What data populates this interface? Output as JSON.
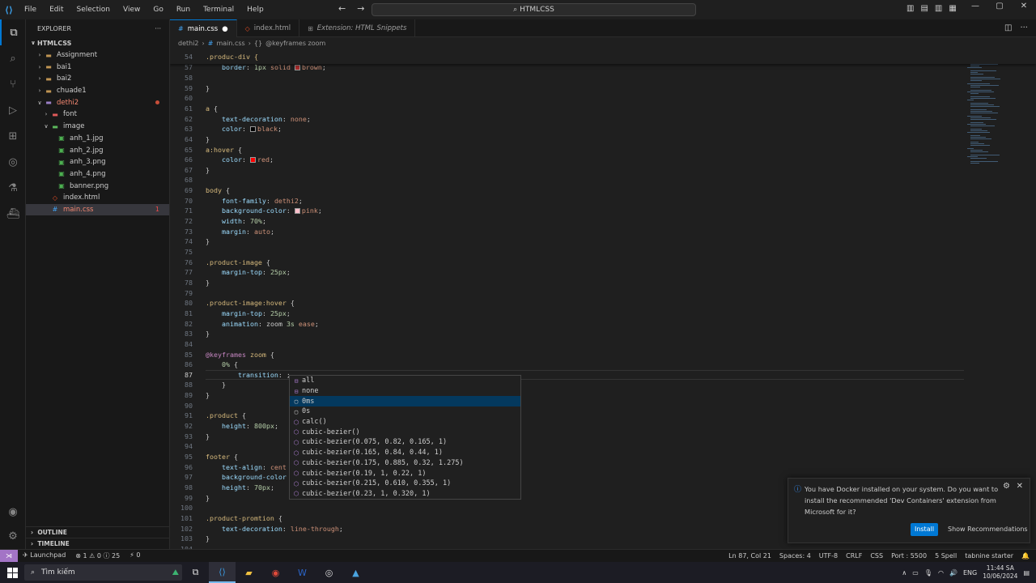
{
  "menu": [
    "File",
    "Edit",
    "Selection",
    "View",
    "Go",
    "Run",
    "Terminal",
    "Help"
  ],
  "search": {
    "text": "HTMLCSS"
  },
  "sidebar": {
    "title": "EXPLORER",
    "root": "HTMLCSS",
    "items": [
      {
        "label": "Assignment",
        "type": "folder",
        "depth": 1,
        "open": false
      },
      {
        "label": "bai1",
        "type": "folder",
        "depth": 1,
        "open": false
      },
      {
        "label": "bai2",
        "type": "folder",
        "depth": 1,
        "open": false
      },
      {
        "label": "chuade1",
        "type": "folder",
        "depth": 1,
        "open": false
      },
      {
        "label": "dethi2",
        "type": "folder",
        "depth": 1,
        "open": true,
        "error": true
      },
      {
        "label": "font",
        "type": "folder",
        "depth": 2,
        "open": false
      },
      {
        "label": "image",
        "type": "folder",
        "depth": 2,
        "open": true
      },
      {
        "label": "anh_1.jpg",
        "type": "img",
        "depth": 3
      },
      {
        "label": "anh_2.jpg",
        "type": "img",
        "depth": 3
      },
      {
        "label": "anh_3.png",
        "type": "img",
        "depth": 3
      },
      {
        "label": "anh_4.png",
        "type": "img",
        "depth": 3
      },
      {
        "label": "banner.png",
        "type": "img",
        "depth": 3
      },
      {
        "label": "index.html",
        "type": "html",
        "depth": 2
      },
      {
        "label": "main.css",
        "type": "css",
        "depth": 2,
        "selected": true,
        "count": "1"
      }
    ],
    "outline": "OUTLINE",
    "timeline": "TIMELINE"
  },
  "tabs": [
    {
      "label": "main.css",
      "active": true,
      "icon": "css-file-icon",
      "dirty": true
    },
    {
      "label": "index.html",
      "active": false,
      "icon": "html-file-icon"
    },
    {
      "label": "Extension: HTML Snippets",
      "active": false,
      "icon": "extension-icon",
      "italic": true
    }
  ],
  "breadcrumb": {
    "folder": "dethi2",
    "file": "main.css",
    "symbol": "@keyframes zoom"
  },
  "sticky": {
    "num": "54",
    "text": ".produc-div {"
  },
  "lines": [
    {
      "n": "57",
      "t": [
        [
          "    ",
          "punct"
        ],
        [
          "border",
          "prop"
        ],
        [
          ": ",
          "punct"
        ],
        [
          "1px",
          "num"
        ],
        [
          " solid ",
          "val"
        ],
        [
          "#SW#brown",
          "val"
        ],
        [
          ";",
          "punct"
        ]
      ]
    },
    {
      "n": "58",
      "t": []
    },
    {
      "n": "59",
      "t": [
        [
          "}",
          "brace"
        ]
      ]
    },
    {
      "n": "60",
      "t": []
    },
    {
      "n": "61",
      "t": [
        [
          "a",
          "sel"
        ],
        [
          " {",
          "brace"
        ]
      ]
    },
    {
      "n": "62",
      "t": [
        [
          "    ",
          "punct"
        ],
        [
          "text-decoration",
          "prop"
        ],
        [
          ": ",
          "punct"
        ],
        [
          "none",
          "val"
        ],
        [
          ";",
          "punct"
        ]
      ]
    },
    {
      "n": "63",
      "t": [
        [
          "    ",
          "punct"
        ],
        [
          "color",
          "prop"
        ],
        [
          ": ",
          "punct"
        ],
        [
          "#SWK#black",
          "val"
        ],
        [
          ";",
          "punct"
        ]
      ]
    },
    {
      "n": "64",
      "t": [
        [
          "}",
          "brace"
        ]
      ]
    },
    {
      "n": "65",
      "t": [
        [
          "a",
          "sel"
        ],
        [
          ":hover",
          "sel"
        ],
        [
          " {",
          "brace"
        ]
      ]
    },
    {
      "n": "66",
      "t": [
        [
          "    ",
          "punct"
        ],
        [
          "color",
          "prop"
        ],
        [
          ": ",
          "punct"
        ],
        [
          "#SWR#red",
          "val"
        ],
        [
          ";",
          "punct"
        ]
      ]
    },
    {
      "n": "67",
      "t": [
        [
          "}",
          "brace"
        ]
      ]
    },
    {
      "n": "68",
      "t": []
    },
    {
      "n": "69",
      "t": [
        [
          "body",
          "sel"
        ],
        [
          " {",
          "brace"
        ]
      ]
    },
    {
      "n": "70",
      "t": [
        [
          "    ",
          "punct"
        ],
        [
          "font-family",
          "prop"
        ],
        [
          ": ",
          "punct"
        ],
        [
          "dethi2",
          "val"
        ],
        [
          ";",
          "punct"
        ]
      ]
    },
    {
      "n": "71",
      "t": [
        [
          "    ",
          "punct"
        ],
        [
          "background-color",
          "prop"
        ],
        [
          ": ",
          "punct"
        ],
        [
          "#SWP#pink",
          "val"
        ],
        [
          ";",
          "punct"
        ]
      ]
    },
    {
      "n": "72",
      "t": [
        [
          "    ",
          "punct"
        ],
        [
          "width",
          "prop"
        ],
        [
          ": ",
          "punct"
        ],
        [
          "70%",
          "num"
        ],
        [
          ";",
          "punct"
        ]
      ]
    },
    {
      "n": "73",
      "t": [
        [
          "    ",
          "punct"
        ],
        [
          "margin",
          "prop"
        ],
        [
          ": ",
          "punct"
        ],
        [
          "auto",
          "val"
        ],
        [
          ";",
          "punct"
        ]
      ]
    },
    {
      "n": "74",
      "t": [
        [
          "}",
          "brace"
        ]
      ]
    },
    {
      "n": "75",
      "t": []
    },
    {
      "n": "76",
      "t": [
        [
          ".product-image",
          "sel"
        ],
        [
          " {",
          "brace"
        ]
      ]
    },
    {
      "n": "77",
      "t": [
        [
          "    ",
          "punct"
        ],
        [
          "margin-top",
          "prop"
        ],
        [
          ": ",
          "punct"
        ],
        [
          "25px",
          "num"
        ],
        [
          ";",
          "punct"
        ]
      ]
    },
    {
      "n": "78",
      "t": [
        [
          "}",
          "brace"
        ]
      ]
    },
    {
      "n": "79",
      "t": []
    },
    {
      "n": "80",
      "t": [
        [
          ".product-image:hover",
          "sel"
        ],
        [
          " {",
          "brace"
        ]
      ]
    },
    {
      "n": "81",
      "t": [
        [
          "    ",
          "punct"
        ],
        [
          "margin-top",
          "prop"
        ],
        [
          ": ",
          "punct"
        ],
        [
          "25px",
          "num"
        ],
        [
          ";",
          "punct"
        ]
      ]
    },
    {
      "n": "82",
      "t": [
        [
          "    ",
          "punct"
        ],
        [
          "animation",
          "prop"
        ],
        [
          ": ",
          "punct"
        ],
        [
          "zoom ",
          "punct"
        ],
        [
          "3s",
          "num"
        ],
        [
          " ease",
          "val"
        ],
        [
          ";",
          "punct"
        ]
      ]
    },
    {
      "n": "83",
      "t": [
        [
          "}",
          "brace"
        ]
      ]
    },
    {
      "n": "84",
      "t": []
    },
    {
      "n": "85",
      "t": [
        [
          "@keyframes",
          "kw"
        ],
        [
          " zoom",
          "sel"
        ],
        [
          " {",
          "brace"
        ]
      ]
    },
    {
      "n": "86",
      "t": [
        [
          "    ",
          "punct"
        ],
        [
          "0%",
          "num"
        ],
        [
          " {",
          "brace"
        ]
      ]
    },
    {
      "n": "87",
      "t": [
        [
          "        ",
          "punct"
        ],
        [
          "transition",
          "prop"
        ],
        [
          ": ;",
          "punct"
        ]
      ],
      "cur": true
    },
    {
      "n": "88",
      "t": [
        [
          "    ",
          "punct"
        ],
        [
          "}",
          "brace"
        ]
      ]
    },
    {
      "n": "89",
      "t": [
        [
          "}",
          "brace"
        ]
      ]
    },
    {
      "n": "90",
      "t": []
    },
    {
      "n": "91",
      "t": [
        [
          ".product",
          "sel"
        ],
        [
          " {",
          "brace"
        ]
      ]
    },
    {
      "n": "92",
      "t": [
        [
          "    ",
          "punct"
        ],
        [
          "height",
          "prop"
        ],
        [
          ": ",
          "punct"
        ],
        [
          "800px",
          "num"
        ],
        [
          ";",
          "punct"
        ]
      ]
    },
    {
      "n": "93",
      "t": [
        [
          "}",
          "brace"
        ]
      ]
    },
    {
      "n": "94",
      "t": []
    },
    {
      "n": "95",
      "t": [
        [
          "footer",
          "sel"
        ],
        [
          " {",
          "brace"
        ]
      ]
    },
    {
      "n": "96",
      "t": [
        [
          "    ",
          "punct"
        ],
        [
          "text-align",
          "prop"
        ],
        [
          ": ",
          "punct"
        ],
        [
          "cent",
          "val"
        ]
      ]
    },
    {
      "n": "97",
      "t": [
        [
          "    ",
          "punct"
        ],
        [
          "background-color",
          "prop"
        ]
      ]
    },
    {
      "n": "98",
      "t": [
        [
          "    ",
          "punct"
        ],
        [
          "height",
          "prop"
        ],
        [
          ": ",
          "punct"
        ],
        [
          "70px",
          "num"
        ],
        [
          ";",
          "punct"
        ]
      ]
    },
    {
      "n": "99",
      "t": [
        [
          "}",
          "brace"
        ]
      ]
    },
    {
      "n": "100",
      "t": []
    },
    {
      "n": "101",
      "t": [
        [
          ".product-promtion",
          "sel"
        ],
        [
          " {",
          "brace"
        ]
      ]
    },
    {
      "n": "102",
      "t": [
        [
          "    ",
          "punct"
        ],
        [
          "text-decoration",
          "prop"
        ],
        [
          ": ",
          "punct"
        ],
        [
          "line-through",
          "val"
        ],
        [
          ";",
          "punct"
        ]
      ]
    },
    {
      "n": "103",
      "t": [
        [
          "}",
          "brace"
        ]
      ]
    },
    {
      "n": "104",
      "t": []
    }
  ],
  "suggest": [
    {
      "label": "all",
      "kind": "kw"
    },
    {
      "label": "none",
      "kind": "kw"
    },
    {
      "label": "0ms",
      "kind": "unit",
      "hi": true
    },
    {
      "label": "0s",
      "kind": "unit"
    },
    {
      "label": "calc()",
      "kind": "fn"
    },
    {
      "label": "cubic-bezier()",
      "kind": "fn"
    },
    {
      "label": "cubic-bezier(0.075, 0.82, 0.165, 1)",
      "kind": "fn"
    },
    {
      "label": "cubic-bezier(0.165, 0.84, 0.44, 1)",
      "kind": "fn"
    },
    {
      "label": "cubic-bezier(0.175, 0.885, 0.32, 1.275)",
      "kind": "fn"
    },
    {
      "label": "cubic-bezier(0.19, 1, 0.22, 1)",
      "kind": "fn"
    },
    {
      "label": "cubic-bezier(0.215, 0.610, 0.355, 1)",
      "kind": "fn"
    },
    {
      "label": "cubic-bezier(0.23, 1, 0.320, 1)",
      "kind": "fn"
    }
  ],
  "toast": {
    "message": "You have Docker installed on your system. Do you want to install the recommended 'Dev Containers' extension from Microsoft for it?",
    "install": "Install",
    "recommendations": "Show Recommendations"
  },
  "status": {
    "launchpad": "Launchpad",
    "problems": "⊗ 1 ⚠ 0 ⓘ 25",
    "ports": "⚡ 0",
    "position": "Ln 87, Col 21",
    "spaces": "Spaces: 4",
    "encoding": "UTF-8",
    "eol": "CRLF",
    "lang": "CSS",
    "port": "Port : 5500",
    "spell": "5 Spell",
    "tabnine": "tabnine starter"
  },
  "taskbar": {
    "search_placeholder": "Tìm kiếm",
    "lang": "ENG",
    "time": "11:44 SA",
    "date": "10/06/2024"
  },
  "colors": {
    "accent": "#0078d4",
    "remote": "#a374c6"
  }
}
